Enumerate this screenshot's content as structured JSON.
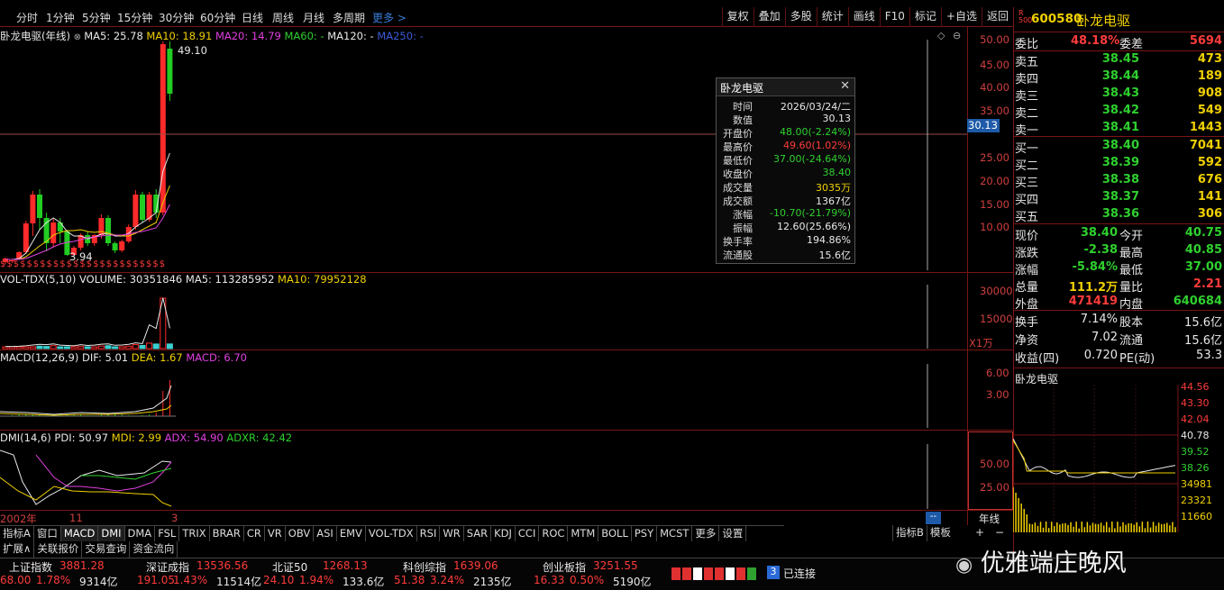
{
  "periods": [
    "分时",
    "1分钟",
    "5分钟",
    "15分钟",
    "30分钟",
    "60分钟",
    "日线",
    "周线",
    "月线",
    "多周期",
    "更多 >"
  ],
  "tools": [
    "复权",
    "叠加",
    "多股",
    "统计",
    "画线",
    "F10",
    "标记",
    "+自选",
    "返回"
  ],
  "main": {
    "title": "卧龙电驱(年线)",
    "ma": [
      {
        "t": "MA5: 25.78",
        "c": "#e8e8e8"
      },
      {
        "t": "MA10: 18.91",
        "c": "#f0d000"
      },
      {
        "t": "MA20: 14.79",
        "c": "#e040e0"
      },
      {
        "t": "MA60: -",
        "c": "#2fd02f"
      },
      {
        "t": "MA120: -",
        "c": "#e8e8e8"
      },
      {
        "t": "MA250: -",
        "c": "#3b5bd8"
      }
    ],
    "high_label": "49.10",
    "low_label": "3.94",
    "crosshair": "30.13",
    "yticks": [
      "50.00",
      "45.00",
      "40.00",
      "35.00",
      "30.00",
      "25.00",
      "20.00",
      "15.00",
      "10.00"
    ]
  },
  "vol": {
    "title": "VOL-TDX(5,10)",
    "items": [
      {
        "t": "VOLUME: 30351846",
        "c": "#e8e8e8"
      },
      {
        "t": "MA5: 113285952",
        "c": "#e8e8e8"
      },
      {
        "t": "MA10: 79952128",
        "c": "#f0d000"
      }
    ],
    "yticks": [
      "30000",
      "15000"
    ],
    "unit": "X1万"
  },
  "macd": {
    "title": "MACD(12,26,9)",
    "items": [
      {
        "t": "DIF: 5.01",
        "c": "#e8e8e8"
      },
      {
        "t": "DEA: 1.67",
        "c": "#f0d000"
      },
      {
        "t": "MACD: 6.70",
        "c": "#e040e0"
      }
    ],
    "yticks": [
      "6.00",
      "3.00"
    ]
  },
  "dmi": {
    "title": "DMI(14,6)",
    "items": [
      {
        "t": "PDI: 50.97",
        "c": "#e8e8e8"
      },
      {
        "t": "MDI: 2.99",
        "c": "#f0d000"
      },
      {
        "t": "ADX: 54.90",
        "c": "#e040e0"
      },
      {
        "t": "ADXR: 42.42",
        "c": "#2fd02f"
      }
    ],
    "yticks": [
      "50.00",
      "25.00"
    ]
  },
  "xaxis": {
    "a": "2002年",
    "b": "11",
    "c": "3",
    "cur": "--",
    "right": "年线"
  },
  "tooltip": {
    "title": "卧龙电驱",
    "rows": [
      {
        "k": "时间",
        "v": "2026/03/24/二",
        "c": "#e8e8e8"
      },
      {
        "k": "数值",
        "v": "30.13",
        "c": "#e8e8e8"
      },
      {
        "k": "开盘价",
        "v": "48.00(-2.24%)",
        "c": "#2fd02f"
      },
      {
        "k": "最高价",
        "v": "49.60(1.02%)",
        "c": "#ff3b3b"
      },
      {
        "k": "最低价",
        "v": "37.00(-24.64%)",
        "c": "#2fd02f"
      },
      {
        "k": "收盘价",
        "v": "38.40",
        "c": "#2fd02f"
      },
      {
        "k": "成交量",
        "v": "3035万",
        "c": "#f0d000"
      },
      {
        "k": "成交额",
        "v": "1367亿",
        "c": "#e8e8e8"
      },
      {
        "k": "涨幅",
        "v": "-10.70(-21.79%)",
        "c": "#2fd02f"
      },
      {
        "k": "振幅",
        "v": "12.60(25.66%)",
        "c": "#e8e8e8"
      },
      {
        "k": "换手率",
        "v": "194.86%",
        "c": "#e8e8e8"
      },
      {
        "k": "流通股",
        "v": "15.6亿",
        "c": "#e8e8e8"
      }
    ]
  },
  "quote": {
    "code": "600580",
    "name": "卧龙电驱",
    "badge_top": "R",
    "badge_bot": "500",
    "wb_label": "委比",
    "wb": "48.18%",
    "wc_label": "委差",
    "wc": "5694",
    "asks": [
      {
        "l": "卖五",
        "p": "38.45",
        "v": "473"
      },
      {
        "l": "卖四",
        "p": "38.44",
        "v": "189"
      },
      {
        "l": "卖三",
        "p": "38.43",
        "v": "908"
      },
      {
        "l": "卖二",
        "p": "38.42",
        "v": "549"
      },
      {
        "l": "卖一",
        "p": "38.41",
        "v": "1443"
      }
    ],
    "bids": [
      {
        "l": "买一",
        "p": "38.40",
        "v": "7041"
      },
      {
        "l": "买二",
        "p": "38.39",
        "v": "592"
      },
      {
        "l": "买三",
        "p": "38.38",
        "v": "676"
      },
      {
        "l": "买四",
        "p": "38.37",
        "v": "141"
      },
      {
        "l": "买五",
        "p": "38.36",
        "v": "306"
      }
    ],
    "stats": [
      {
        "l1": "现价",
        "v1": "38.40",
        "c1": "#2fd02f",
        "l2": "今开",
        "v2": "40.75",
        "c2": "#2fd02f"
      },
      {
        "l1": "涨跌",
        "v1": "-2.38",
        "c1": "#2fd02f",
        "l2": "最高",
        "v2": "40.85",
        "c2": "#2fd02f"
      },
      {
        "l1": "涨幅",
        "v1": "-5.84%",
        "c1": "#2fd02f",
        "l2": "最低",
        "v2": "37.00",
        "c2": "#2fd02f"
      },
      {
        "l1": "总量",
        "v1": "111.2万",
        "c1": "#f0d000",
        "l2": "量比",
        "v2": "2.21",
        "c2": "#ff3b3b"
      },
      {
        "l1": "外盘",
        "v1": "471419",
        "c1": "#ff3b3b",
        "l2": "内盘",
        "v2": "640684",
        "c2": "#2fd02f"
      }
    ],
    "stats2": [
      {
        "l1": "换手",
        "v1": "7.14%",
        "l2": "股本",
        "v2": "15.6亿"
      },
      {
        "l1": "净资",
        "v1": "7.02",
        "l2": "流通",
        "v2": "15.6亿"
      },
      {
        "l1": "收益(四)",
        "v1": "0.720",
        "l2": "PE(动)",
        "v2": "53.3"
      }
    ]
  },
  "mini": {
    "name": "卧龙电驱",
    "prices": [
      "44.56",
      "43.30",
      "42.04",
      "40.78",
      "39.52",
      "38.26",
      "34981",
      "23321",
      "11660"
    ]
  },
  "indicators": [
    "指标A",
    "窗口",
    "MACD",
    "DMI",
    "DMA",
    "FSL",
    "TRIX",
    "BRAR",
    "CR",
    "VR",
    "OBV",
    "ASI",
    "EMV",
    "VOL-TDX",
    "RSI",
    "WR",
    "SAR",
    "KDJ",
    "CCI",
    "ROC",
    "MTM",
    "BOLL",
    "PSY",
    "MCST",
    "更多",
    "设置"
  ],
  "ind_right": [
    "指标B",
    "模板"
  ],
  "subtabs": [
    "扩展∧",
    "关联报价",
    "交易查询",
    "资金流向"
  ],
  "indices": [
    {
      "n": "上证指数",
      "v": "3881.28",
      "d": "68.00",
      "p": "1.78%",
      "a": "9314亿"
    },
    {
      "n": "深证成指",
      "v": "13536.56",
      "d": "191.05",
      "p": "1.43%",
      "a": "11514亿"
    },
    {
      "n": "北证50",
      "v": "1268.13",
      "d": "24.10",
      "p": "1.94%",
      "a": "133.6亿"
    },
    {
      "n": "科创综指",
      "v": "1639.06",
      "d": "51.38",
      "p": "3.24%",
      "a": "2135亿"
    },
    {
      "n": "创业板指",
      "v": "3251.55",
      "d": "16.33",
      "p": "0.50%",
      "a": "5190亿"
    }
  ],
  "conn": {
    "num": "3",
    "text": "已连接"
  },
  "watermark": "优雅端庄晚风"
}
